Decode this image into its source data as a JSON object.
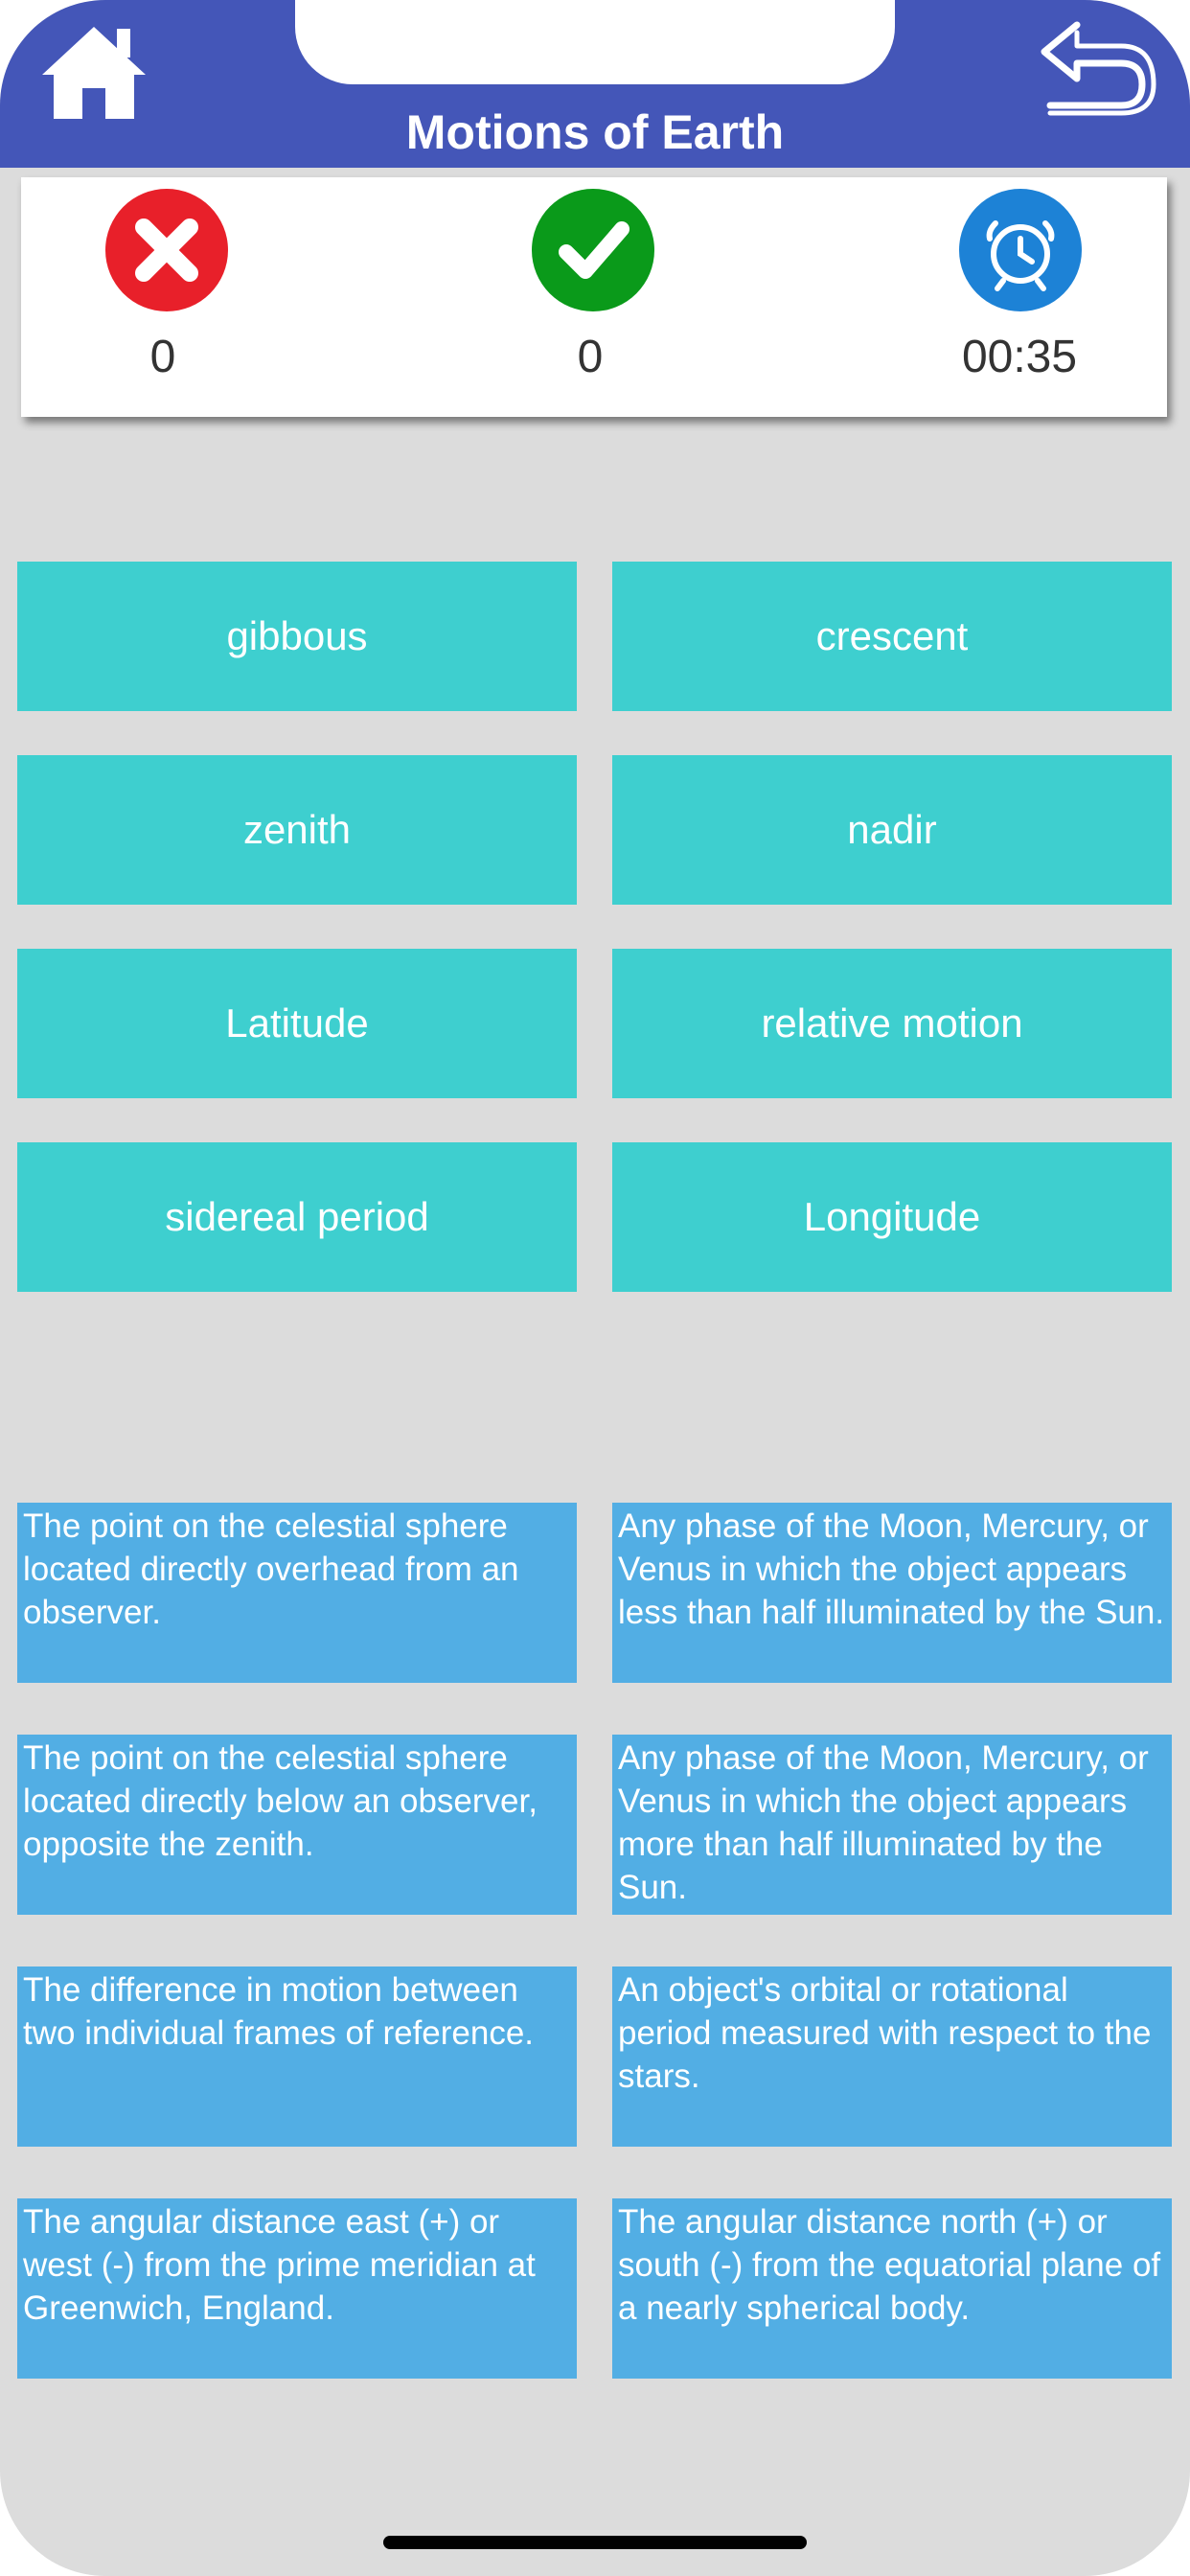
{
  "header": {
    "title": "Motions of Earth",
    "home_icon": "home-icon",
    "back_icon": "back-arrow-icon",
    "color": "#4456b8"
  },
  "score": {
    "wrong": {
      "icon": "wrong-x-icon",
      "value": "0",
      "color": "#e8202a"
    },
    "correct": {
      "icon": "check-icon",
      "value": "0",
      "color": "#0a9a1a"
    },
    "timer": {
      "icon": "alarm-clock-icon",
      "value": "00:35",
      "color": "#1d82d6"
    }
  },
  "terms": [
    {
      "label": "gibbous"
    },
    {
      "label": "crescent"
    },
    {
      "label": "zenith"
    },
    {
      "label": "nadir"
    },
    {
      "label": "Latitude"
    },
    {
      "label": "relative motion"
    },
    {
      "label": "sidereal period"
    },
    {
      "label": "Longitude"
    }
  ],
  "definitions": [
    {
      "text": "The point on the celestial sphere located directly overhead from an observer."
    },
    {
      "text": "Any phase of the Moon, Mercury, or Venus in which the object appears less than half illuminated by the Sun."
    },
    {
      "text": "The point on the celestial sphere located directly below an observer, opposite the zenith."
    },
    {
      "text": "Any phase of the Moon, Mercury, or Venus in which the object appears more than half illuminated by the Sun."
    },
    {
      "text": "The difference in motion between two individual frames of reference."
    },
    {
      "text": "An object's orbital or rotational period measured with respect to the stars."
    },
    {
      "text": "The angular distance east (+) or west (-) from the prime meridian at Greenwich, England."
    },
    {
      "text": "The angular distance north (+) or south (-) from the equatorial plane of a nearly spherical body."
    }
  ],
  "colors": {
    "background": "#dcdcdc",
    "term_button": "#3ecfcf",
    "definition_card": "#52aee4"
  }
}
